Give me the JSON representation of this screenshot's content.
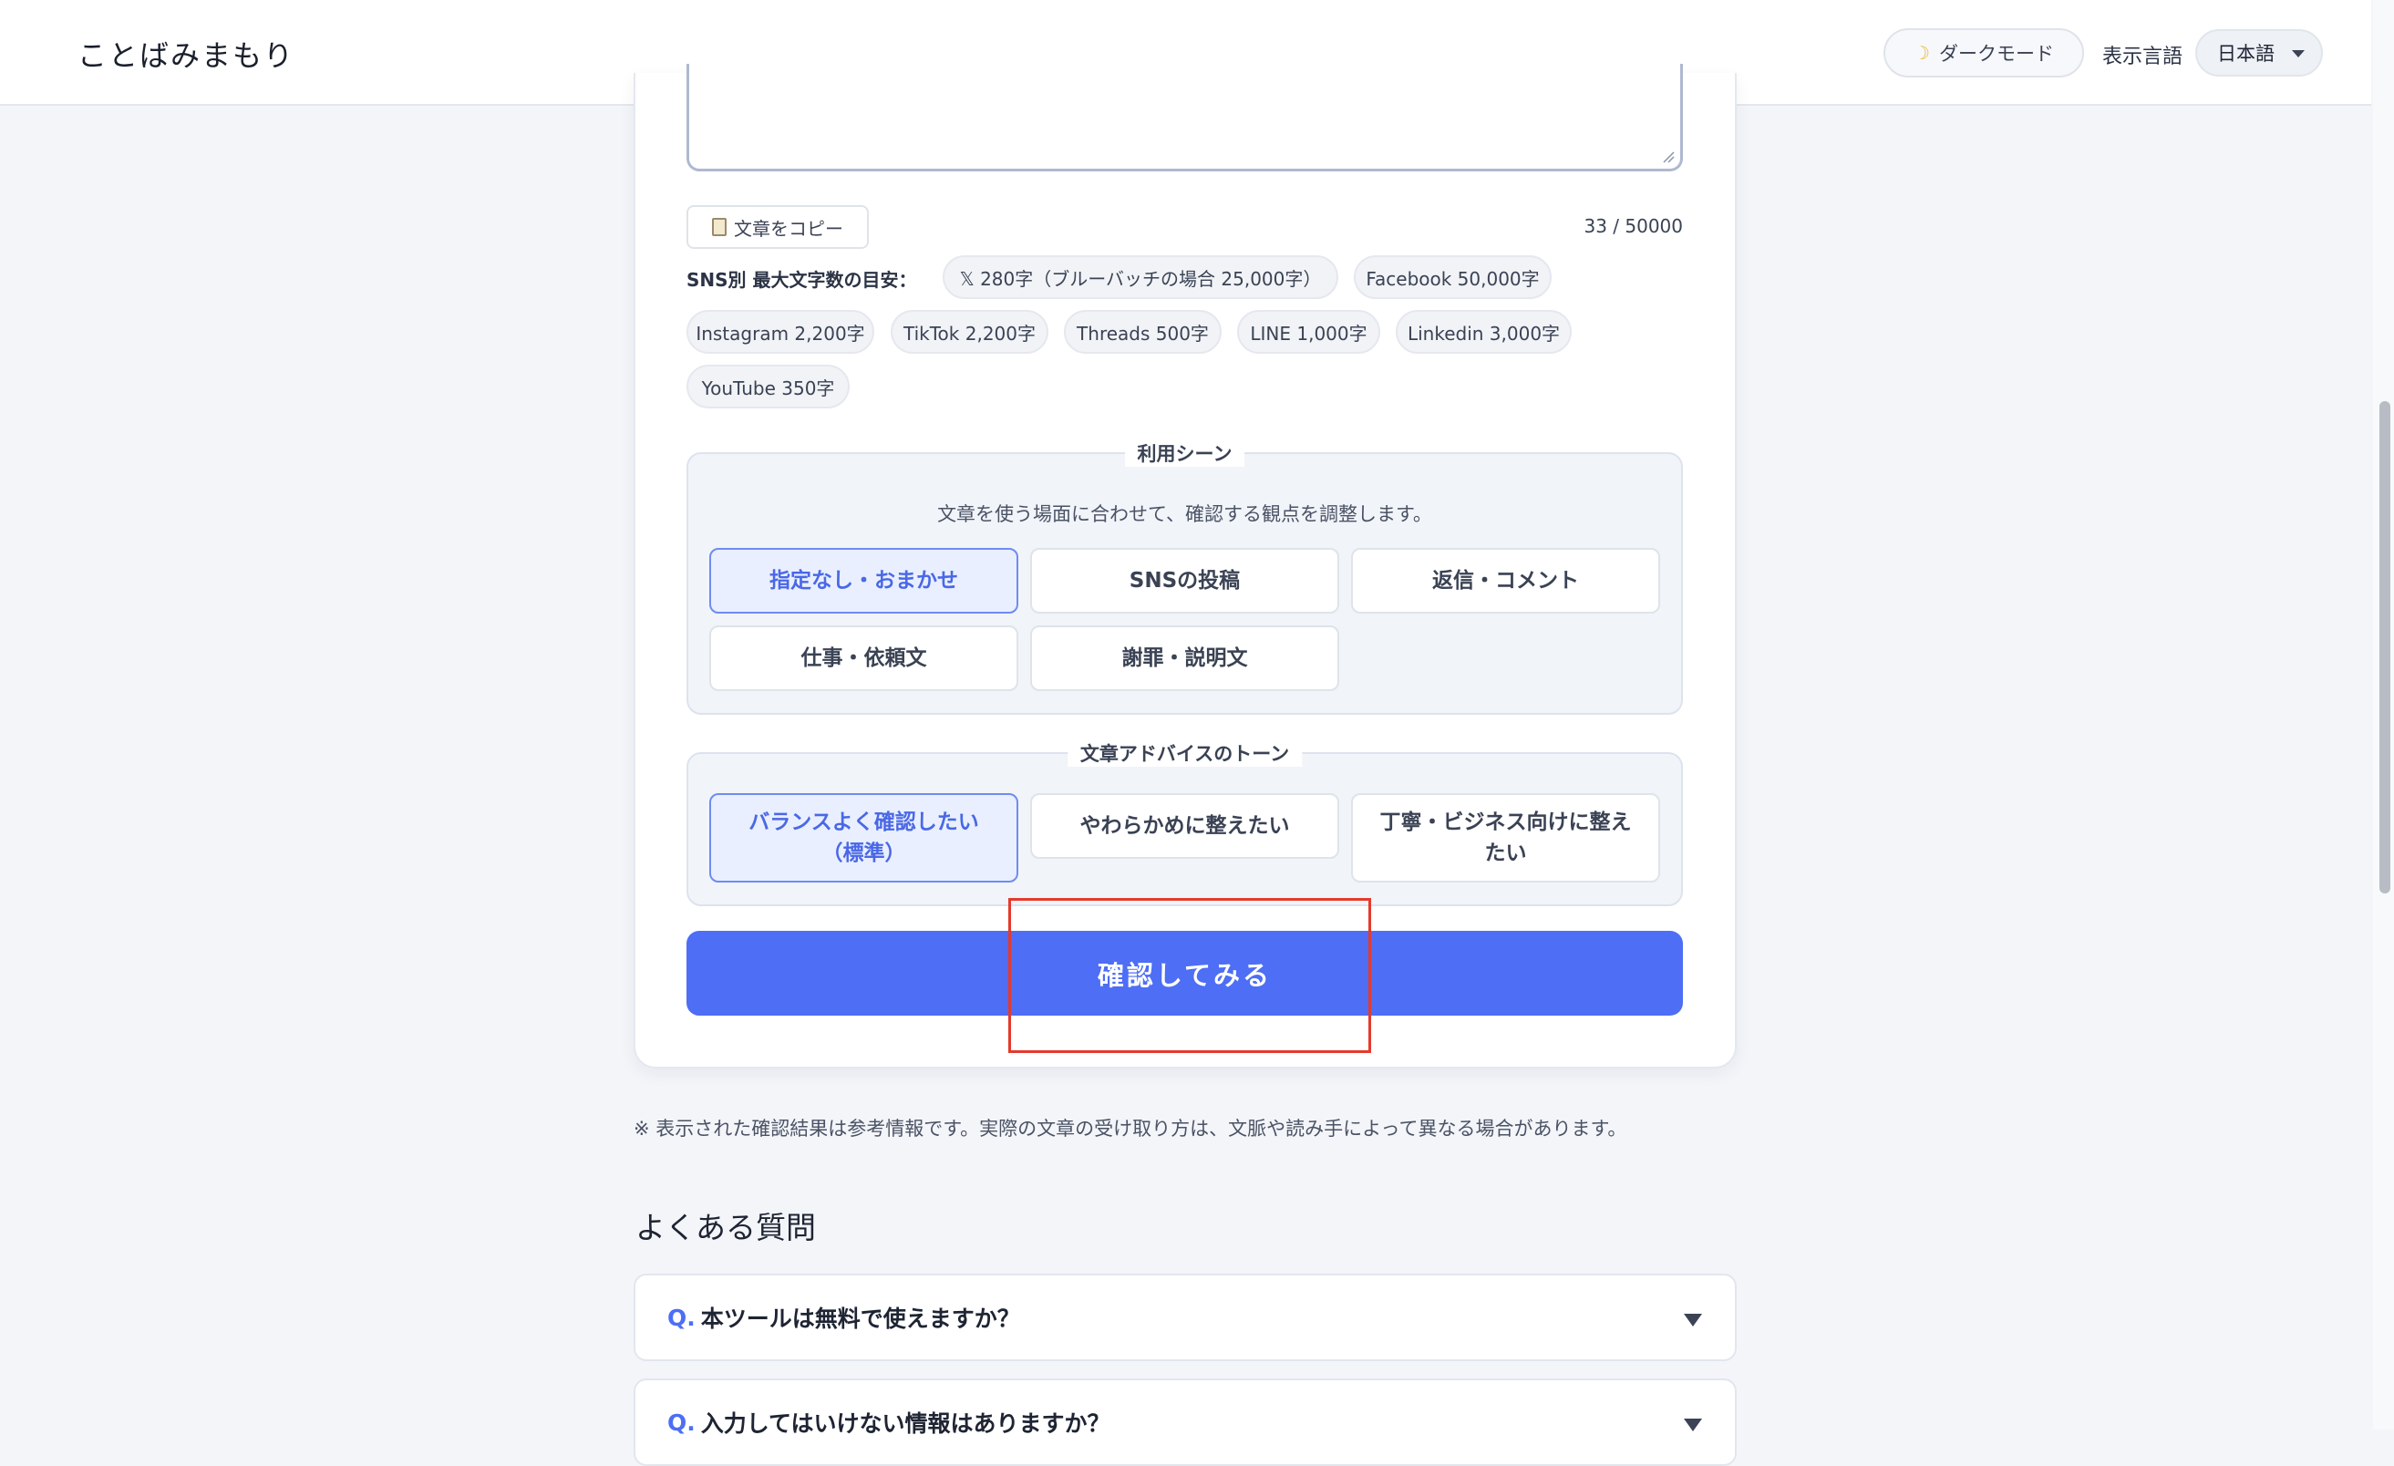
{
  "header": {
    "logo": "ことばみまもり",
    "dark_mode_label": "ダークモード",
    "dark_mode_icon": "moon-icon",
    "language_label": "表示言語",
    "language_value": "日本語"
  },
  "editor": {
    "copy_label": "文章をコピー",
    "copy_icon": "clipboard-icon",
    "counter": "33 / 50000"
  },
  "sns": {
    "label": "SNS別 最大文字数の目安：",
    "chips": [
      "𝕏 280字（ブルーバッチの場合 25,000字）",
      "Facebook 50,000字",
      "Instagram 2,200字",
      "TikTok 2,200字",
      "Threads 500字",
      "LINE 1,000字",
      "Linkedin 3,000字",
      "YouTube 350字"
    ]
  },
  "scene": {
    "legend": "利用シーン",
    "description": "文章を使う場面に合わせて、確認する観点を調整します。",
    "options": [
      "指定なし・おまかせ",
      "SNSの投稿",
      "返信・コメント",
      "仕事・依頼文",
      "謝罪・説明文"
    ],
    "selected": "指定なし・おまかせ"
  },
  "tone": {
    "legend": "文章アドバイスのトーン",
    "options": [
      "バランスよく確認したい（標準）",
      "やわらかめに整えたい",
      "丁寧・ビジネス向けに整えたい"
    ],
    "selected": "バランスよく確認したい（標準）"
  },
  "submit_label": "確認してみる",
  "note": "※ 表示された確認結果は参考情報です。実際の文章の受け取り方は、文脈や読み手によって異なる場合があります。",
  "faq": {
    "title": "よくある質問",
    "q_prefix": "Q.",
    "items": [
      "本ツールは無料で使えますか？",
      "入力してはいけない情報はありますか？"
    ]
  },
  "colors": {
    "accent": "#4d6ef5",
    "highlight_box": "#e53a2c",
    "selected_bg": "#e9efff"
  }
}
